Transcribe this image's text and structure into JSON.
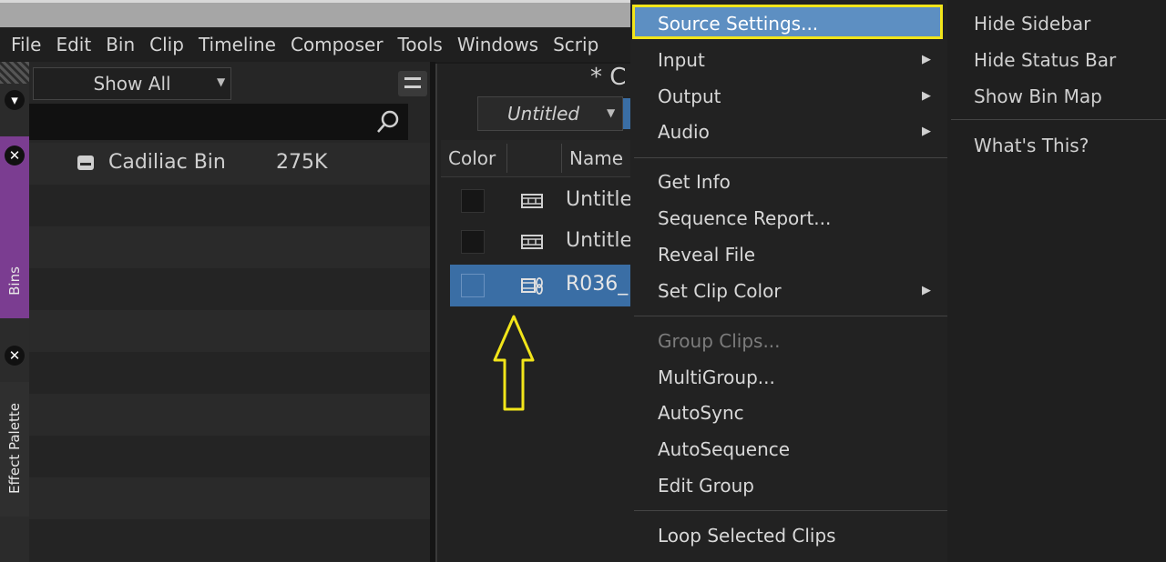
{
  "menubar": {
    "items": [
      "File",
      "Edit",
      "Bin",
      "Clip",
      "Timeline",
      "Composer",
      "Tools",
      "Windows",
      "Scrip"
    ]
  },
  "tabs": {
    "bins_label": "Bins",
    "effect_palette_label": "Effect Palette"
  },
  "bins_panel": {
    "filter_value": "Show All",
    "bin": {
      "name": "Cadiliac Bin",
      "size": "275K"
    }
  },
  "bin_window": {
    "title": "* C",
    "view_dropdown": "Untitled",
    "columns": {
      "color": "Color",
      "name": "Name"
    },
    "clips": [
      {
        "name": "Untitle",
        "type": "sequence"
      },
      {
        "name": "Untitle",
        "type": "sequence"
      },
      {
        "name": "R036_",
        "type": "linked-clip",
        "selected": true
      }
    ]
  },
  "context_menu": {
    "items": [
      {
        "label": "Source Settings...",
        "highlighted": true
      },
      {
        "label": "Input",
        "submenu": true
      },
      {
        "label": "Output",
        "submenu": true
      },
      {
        "label": "Audio",
        "submenu": true
      },
      {
        "label": "Get Info"
      },
      {
        "label": "Sequence Report..."
      },
      {
        "label": "Reveal File"
      },
      {
        "label": "Set Clip Color",
        "submenu": true
      },
      {
        "label": "Group Clips...",
        "disabled": true
      },
      {
        "label": "MultiGroup..."
      },
      {
        "label": "AutoSync"
      },
      {
        "label": "AutoSequence"
      },
      {
        "label": "Edit Group"
      },
      {
        "label": "Loop Selected Clips"
      }
    ]
  },
  "side_menu": {
    "items": [
      "Hide Sidebar",
      "Hide Status Bar",
      "Show Bin Map",
      "What's This?"
    ]
  },
  "colors": {
    "highlight": "#5d8fc2",
    "annotation_yellow": "#f2e51a",
    "bins_tab": "#7b3d91",
    "selected_row": "#3a6ea5"
  }
}
